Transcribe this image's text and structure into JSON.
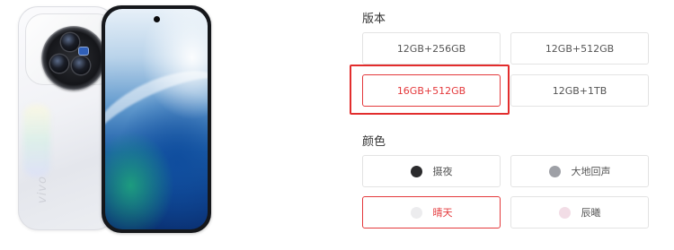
{
  "version": {
    "title": "版本",
    "options": [
      {
        "label": "12GB+256GB",
        "selected": false
      },
      {
        "label": "12GB+512GB",
        "selected": false
      },
      {
        "label": "16GB+512GB",
        "selected": true
      },
      {
        "label": "12GB+1TB",
        "selected": false
      }
    ]
  },
  "color": {
    "title": "颜色",
    "options": [
      {
        "label": "摄夜",
        "swatch": "#2b2b2d",
        "selected": false
      },
      {
        "label": "大地回声",
        "swatch": "#9ea0a6",
        "selected": false
      },
      {
        "label": "晴天",
        "swatch": "#ececee",
        "selected": true
      },
      {
        "label": "辰曦",
        "swatch": "#f2dde6",
        "selected": false
      }
    ]
  },
  "product": {
    "brand_logo": "vivo"
  },
  "colors": {
    "accent": "#e4393c",
    "annotation": "#e22d2d",
    "border": "#e3e3e3"
  }
}
